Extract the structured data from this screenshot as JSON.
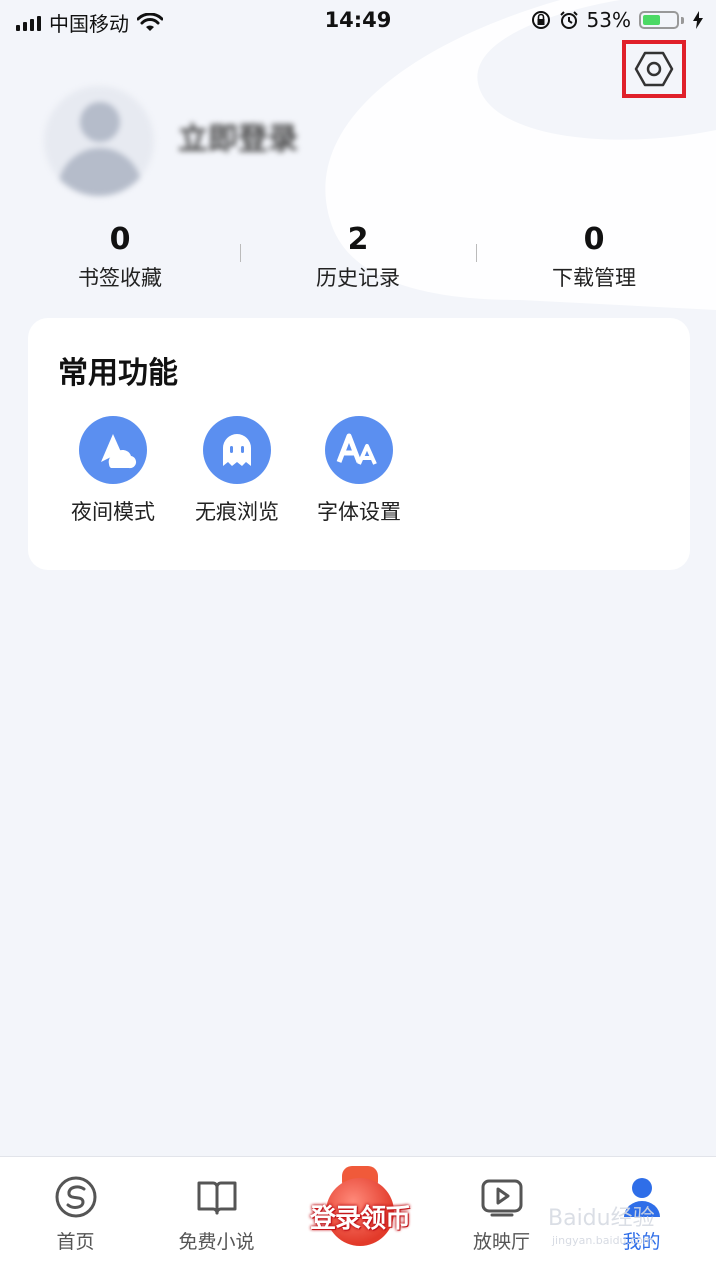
{
  "status_bar": {
    "carrier": "中国移动",
    "time": "14:49",
    "battery_percent": "53%",
    "battery_level": 0.53
  },
  "profile": {
    "login_label": "立即登录"
  },
  "stats": [
    {
      "value": "0",
      "label": "书签收藏"
    },
    {
      "value": "2",
      "label": "历史记录"
    },
    {
      "value": "0",
      "label": "下载管理"
    }
  ],
  "common_functions": {
    "title": "常用功能",
    "items": [
      {
        "label": "夜间模式",
        "icon": "night-mode-icon"
      },
      {
        "label": "无痕浏览",
        "icon": "ghost-icon"
      },
      {
        "label": "字体设置",
        "icon": "font-icon"
      }
    ]
  },
  "tabbar": {
    "items": [
      {
        "label": "首页",
        "icon": "home-s-icon"
      },
      {
        "label": "免费小说",
        "icon": "book-icon"
      },
      {
        "label": "放映厅",
        "icon": "tv-play-icon"
      },
      {
        "label": "我的",
        "icon": "user-icon",
        "active": true
      }
    ],
    "promo_label": "登录领币"
  },
  "watermark": {
    "line1": "Baidu经验",
    "line2": "jingyan.baidu.com"
  },
  "colors": {
    "accent": "#5b8ff0",
    "active_tab": "#2f6ee8",
    "highlight_box": "#e0202a",
    "background": "#f3f5fa"
  }
}
